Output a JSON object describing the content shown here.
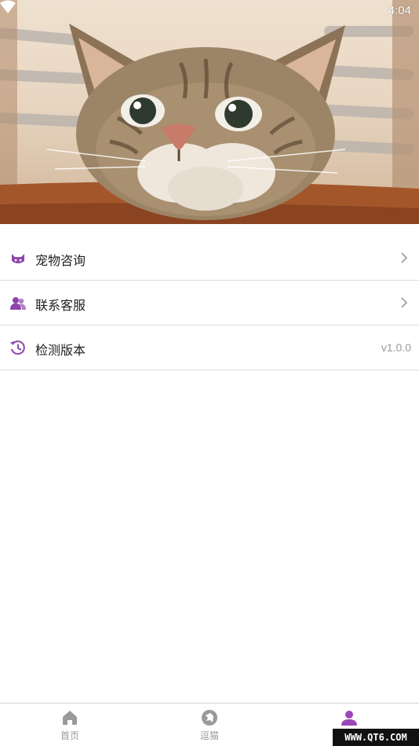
{
  "status_bar": {
    "time": "4:04"
  },
  "menu": {
    "items": [
      {
        "label": "宠物咨询",
        "icon": "cat-icon",
        "trailing": "chevron"
      },
      {
        "label": "联系客服",
        "icon": "users-icon",
        "trailing": "chevron"
      },
      {
        "label": "检测版本",
        "icon": "history-icon",
        "trailing": "version",
        "version": "v1.0.0"
      }
    ]
  },
  "tabbar": {
    "tabs": [
      {
        "label": "首页",
        "icon": "home-icon",
        "active": false
      },
      {
        "label": "逗猫",
        "icon": "pet-icon",
        "active": false
      },
      {
        "label": "",
        "icon": "user-icon",
        "active": true
      }
    ]
  },
  "watermark": "WWW.QT6.COM",
  "colors": {
    "accent": "#9d47b6",
    "icon_purple": "#8e44ad",
    "inactive": "#9a9a9a",
    "divider": "#dcdcdc"
  }
}
